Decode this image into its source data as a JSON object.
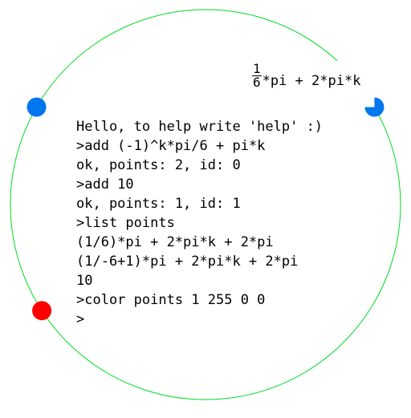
{
  "circle": {
    "color": "#00dd22"
  },
  "points": [
    {
      "id": 0,
      "expression": "(-1)^k*pi/6 + pi*k",
      "angles_rad": [
        0.5236,
        2.618
      ],
      "color": "#0077ee"
    },
    {
      "id": 1,
      "expression": "10",
      "angles_rad": [
        10
      ],
      "color": "#ff0000"
    }
  ],
  "hover_label": {
    "numerator": "1",
    "denominator": "6",
    "rest": "*pi + 2*pi*k"
  },
  "console": {
    "lines": [
      "Hello, to help write 'help' :)",
      ">add (-1)^k*pi/6 + pi*k",
      "ok, points: 2, id: 0",
      ">add 10",
      "ok, points: 1, id: 1",
      ">list points",
      "(1/6)*pi + 2*pi*k + 2*pi",
      "(1/-6+1)*pi + 2*pi*k + 2*pi",
      "10",
      ">color points 1 255 0 0",
      ">"
    ]
  }
}
